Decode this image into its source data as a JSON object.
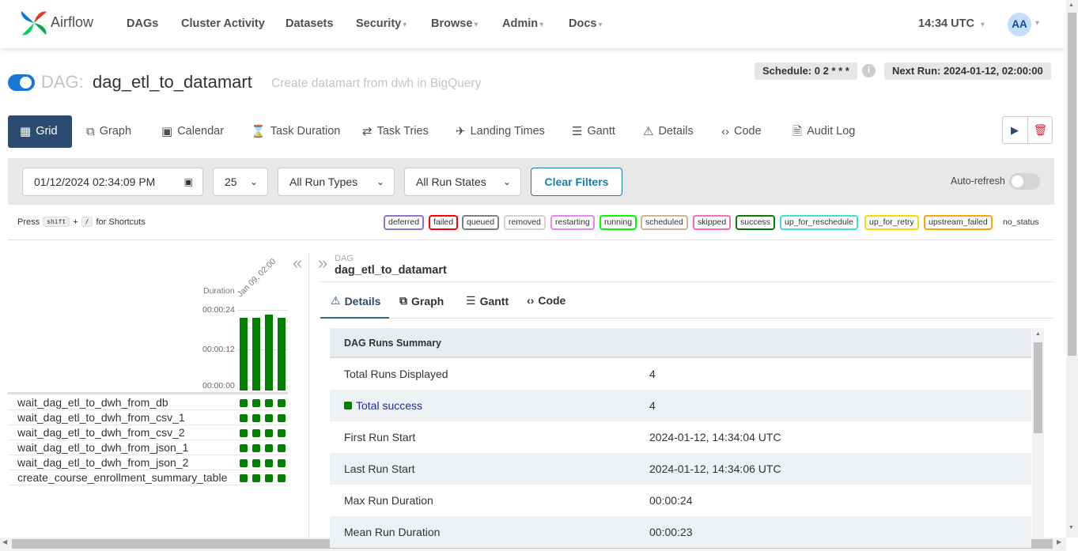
{
  "nav": {
    "brand": "Airflow",
    "items": [
      {
        "label": "DAGs",
        "dropdown": false
      },
      {
        "label": "Cluster Activity",
        "dropdown": false
      },
      {
        "label": "Datasets",
        "dropdown": false
      },
      {
        "label": "Security",
        "dropdown": true
      },
      {
        "label": "Browse",
        "dropdown": true
      },
      {
        "label": "Admin",
        "dropdown": true
      },
      {
        "label": "Docs",
        "dropdown": true
      }
    ],
    "clock": "14:34 UTC",
    "avatar_initials": "AA"
  },
  "dag": {
    "prefix": "DAG:",
    "name": "dag_etl_to_datamart",
    "description": "Create datamart from dwh in BigQuery",
    "schedule": "Schedule: 0 2 * * *",
    "next_run": "Next Run: 2024-01-12, 02:00:00",
    "paused": false
  },
  "tabs": [
    {
      "label": "Grid",
      "icon": "grid-icon",
      "glyph": "▦",
      "active": true
    },
    {
      "label": "Graph",
      "icon": "graph-icon",
      "glyph": "⧉",
      "active": false
    },
    {
      "label": "Calendar",
      "icon": "calendar-icon",
      "glyph": "▣",
      "active": false
    },
    {
      "label": "Task Duration",
      "icon": "hourglass-icon",
      "glyph": "⌛",
      "active": false
    },
    {
      "label": "Task Tries",
      "icon": "retry-icon",
      "glyph": "⇄",
      "active": false
    },
    {
      "label": "Landing Times",
      "icon": "landing-icon",
      "glyph": "✈",
      "active": false
    },
    {
      "label": "Gantt",
      "icon": "gantt-icon",
      "glyph": "☰",
      "active": false
    },
    {
      "label": "Details",
      "icon": "warning-icon",
      "glyph": "⚠",
      "active": false
    },
    {
      "label": "Code",
      "icon": "code-icon",
      "glyph": "‹›",
      "active": false
    },
    {
      "label": "Audit Log",
      "icon": "audit-log-icon",
      "glyph": "🗎",
      "active": false
    }
  ],
  "filters": {
    "base_date": "01/12/2024  02:34:09  PM",
    "num_runs": "25",
    "run_types": "All Run Types",
    "run_states": "All Run States",
    "clear_label": "Clear Filters",
    "autorefresh_label": "Auto-refresh",
    "autorefresh_on": false
  },
  "shortcuts": {
    "press": "Press",
    "key1": "shift",
    "plus": "+",
    "key2": "/",
    "suffix": "for Shortcuts"
  },
  "states": [
    {
      "label": "deferred",
      "color": "#9370db"
    },
    {
      "label": "failed",
      "color": "#ff0000"
    },
    {
      "label": "queued",
      "color": "#808080"
    },
    {
      "label": "removed",
      "color": "#d3d3d3"
    },
    {
      "label": "restarting",
      "color": "#ee82ee"
    },
    {
      "label": "running",
      "color": "#00ff00"
    },
    {
      "label": "scheduled",
      "color": "#d2b48c"
    },
    {
      "label": "skipped",
      "color": "#ff69b4"
    },
    {
      "label": "success",
      "color": "#008000"
    },
    {
      "label": "up_for_reschedule",
      "color": "#40e0d0"
    },
    {
      "label": "up_for_retry",
      "color": "#ffd700"
    },
    {
      "label": "upstream_failed",
      "color": "#ffa500"
    },
    {
      "label": "no_status",
      "color": null
    }
  ],
  "grid": {
    "duration_label": "Duration",
    "run_date_label": "Jan 09, 02:00",
    "ticks": [
      "00:00:24",
      "00:00:12",
      "00:00:00"
    ],
    "run_durations_sec": [
      23,
      23,
      24,
      23
    ],
    "max_duration_sec": 24,
    "tasks": [
      {
        "name": "wait_dag_etl_to_dwh_from_db",
        "states": [
          "success",
          "success",
          "success",
          "success"
        ]
      },
      {
        "name": "wait_dag_etl_to_dwh_from_csv_1",
        "states": [
          "success",
          "success",
          "success",
          "success"
        ]
      },
      {
        "name": "wait_dag_etl_to_dwh_from_csv_2",
        "states": [
          "success",
          "success",
          "success",
          "success"
        ]
      },
      {
        "name": "wait_dag_etl_to_dwh_from_json_1",
        "states": [
          "success",
          "success",
          "success",
          "success"
        ]
      },
      {
        "name": "wait_dag_etl_to_dwh_from_json_2",
        "states": [
          "success",
          "success",
          "success",
          "success"
        ]
      },
      {
        "name": "create_course_enrollment_summary_table",
        "states": [
          "success",
          "success",
          "success",
          "success"
        ]
      }
    ]
  },
  "detail_panel": {
    "crumb_label": "DAG",
    "crumb_value": "dag_etl_to_datamart",
    "tabs": [
      {
        "label": "Details",
        "glyph": "⚠",
        "icon": "warning-icon",
        "active": true
      },
      {
        "label": "Graph",
        "glyph": "⧉",
        "icon": "graph-icon",
        "active": false
      },
      {
        "label": "Gantt",
        "glyph": "☰",
        "icon": "gantt-icon",
        "active": false
      },
      {
        "label": "Code",
        "glyph": "‹›",
        "icon": "code-icon",
        "active": false
      }
    ],
    "summary_title": "DAG Runs Summary",
    "rows": [
      {
        "key": "Total Runs Displayed",
        "value": "4",
        "link": false
      },
      {
        "key": "Total success",
        "value": "4",
        "link": true
      },
      {
        "key": "First Run Start",
        "value": "2024-01-12, 14:34:04 UTC",
        "link": false
      },
      {
        "key": "Last Run Start",
        "value": "2024-01-12, 14:34:06 UTC",
        "link": false
      },
      {
        "key": "Max Run Duration",
        "value": "00:00:24",
        "link": false
      },
      {
        "key": "Mean Run Duration",
        "value": "00:00:23",
        "link": false
      }
    ]
  }
}
